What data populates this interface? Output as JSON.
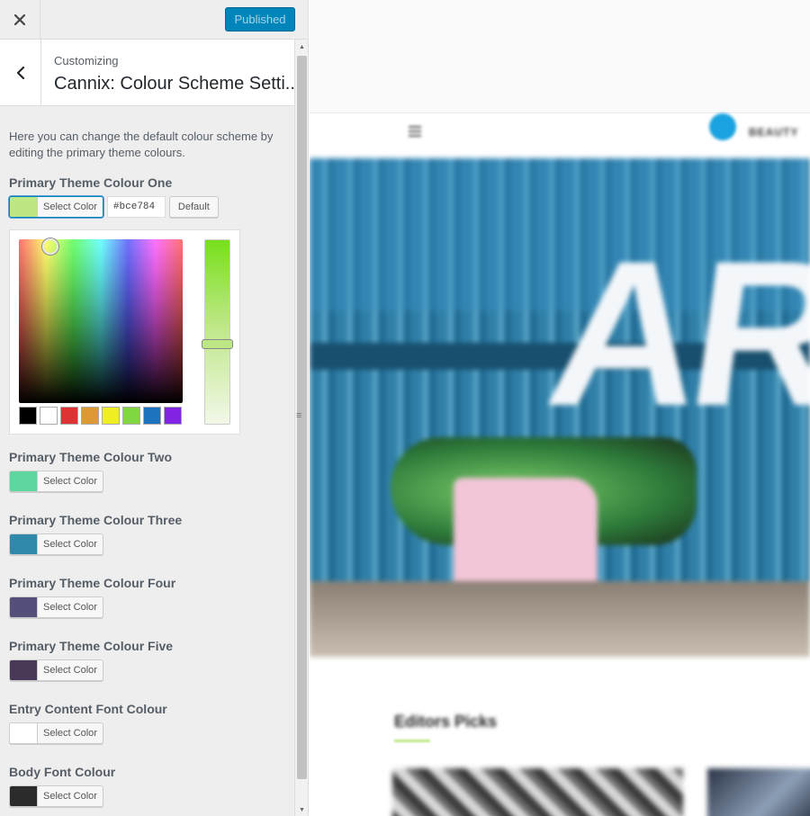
{
  "topbar": {
    "close_icon": "close-icon",
    "publish_label": "Published"
  },
  "section": {
    "back_icon": "chevron-left-icon",
    "breadcrumb": "Customizing",
    "title": "Cannix: Colour Scheme Setti..."
  },
  "description": "Here you can change the default colour scheme by editing the primary theme colours.",
  "select_color_label": "Select Color",
  "default_label": "Default",
  "controls": [
    {
      "label": "Primary Theme Colour One",
      "color": "#bce784",
      "expanded": true,
      "hex_value": "#bce784"
    },
    {
      "label": "Primary Theme Colour Two",
      "color": "#5fd5a0",
      "expanded": false
    },
    {
      "label": "Primary Theme Colour Three",
      "color": "#3088aa",
      "expanded": false
    },
    {
      "label": "Primary Theme Colour Four",
      "color": "#555079",
      "expanded": false
    },
    {
      "label": "Primary Theme Colour Five",
      "color": "#4a3858",
      "expanded": false
    },
    {
      "label": "Entry Content Font Colour",
      "color": "#ffffff",
      "expanded": false
    },
    {
      "label": "Body Font Colour",
      "color": "#2b2b2b",
      "expanded": false
    }
  ],
  "picker": {
    "palette": [
      "#000000",
      "#ffffff",
      "#dd3333",
      "#dd9933",
      "#eeee22",
      "#81d742",
      "#1e73be",
      "#8224e3"
    ]
  },
  "preview": {
    "nav_text": "BEAUTY",
    "hero_text": "ART",
    "section_title": "Editors Picks"
  }
}
